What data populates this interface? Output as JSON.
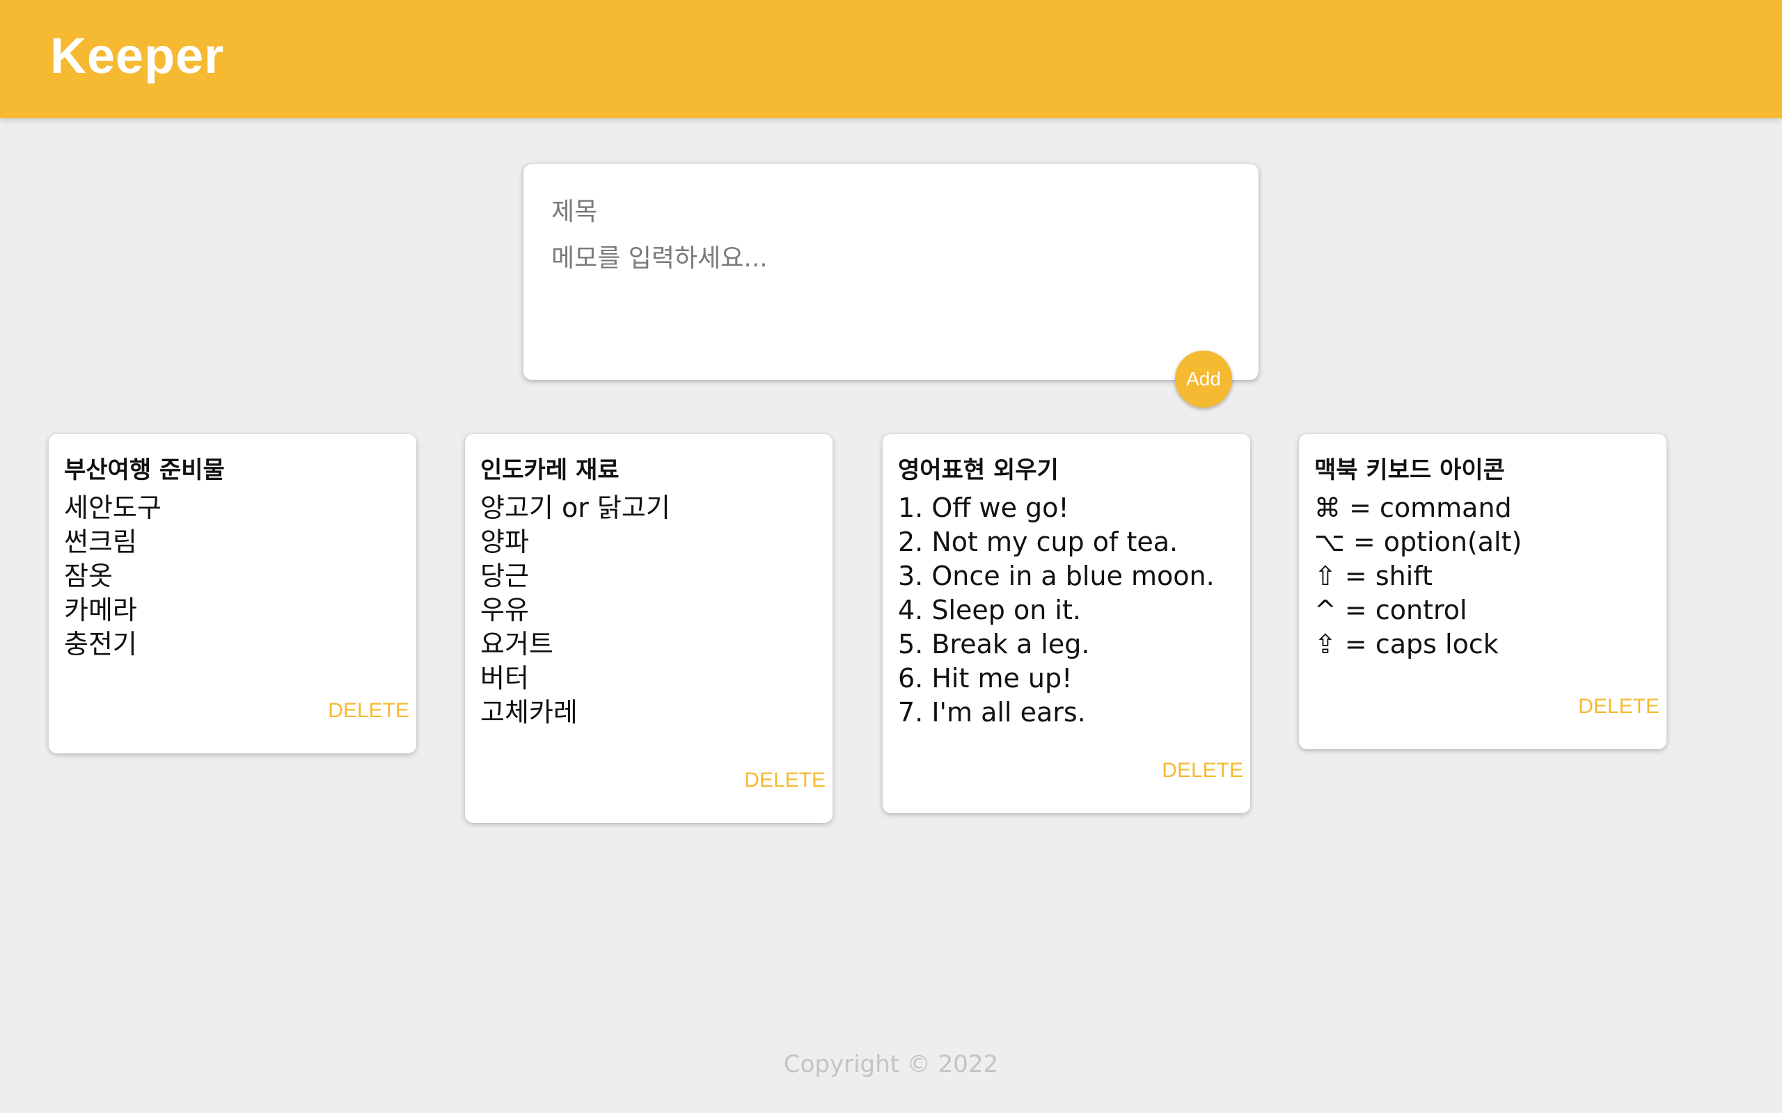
{
  "header": {
    "title": "Keeper"
  },
  "create_form": {
    "title_placeholder": "제목",
    "content_placeholder": "메모를 입력하세요...",
    "add_label": "Add"
  },
  "notes": [
    {
      "title": "부산여행 준비물",
      "lines": [
        "세안도구",
        "썬크림",
        "잠옷",
        "카메라",
        "충전기"
      ],
      "delete_label": "DELETE"
    },
    {
      "title": "인도카레 재료",
      "lines": [
        "양고기 or 닭고기",
        "양파",
        "당근",
        "우유",
        "요거트",
        "버터",
        "고체카레"
      ],
      "delete_label": "DELETE"
    },
    {
      "title": "영어표현 외우기",
      "lines": [
        "1. Off we go!",
        "2. Not my cup of tea.",
        "3. Once in a blue moon.",
        "4. Sleep on it.",
        "5. Break a leg.",
        "6. Hit me up!",
        "7. I'm all ears."
      ],
      "delete_label": "DELETE"
    },
    {
      "title": "맥북 키보드 아이콘",
      "lines": [
        "⌘ = command",
        "⌥ = option(alt)",
        "⇧ = shift",
        "^ = control",
        "⇪ = caps lock"
      ],
      "delete_label": "DELETE"
    }
  ],
  "footer": {
    "text": "Copyright © 2022"
  },
  "colors": {
    "accent": "#f5ba32",
    "background": "#eeeeee"
  }
}
